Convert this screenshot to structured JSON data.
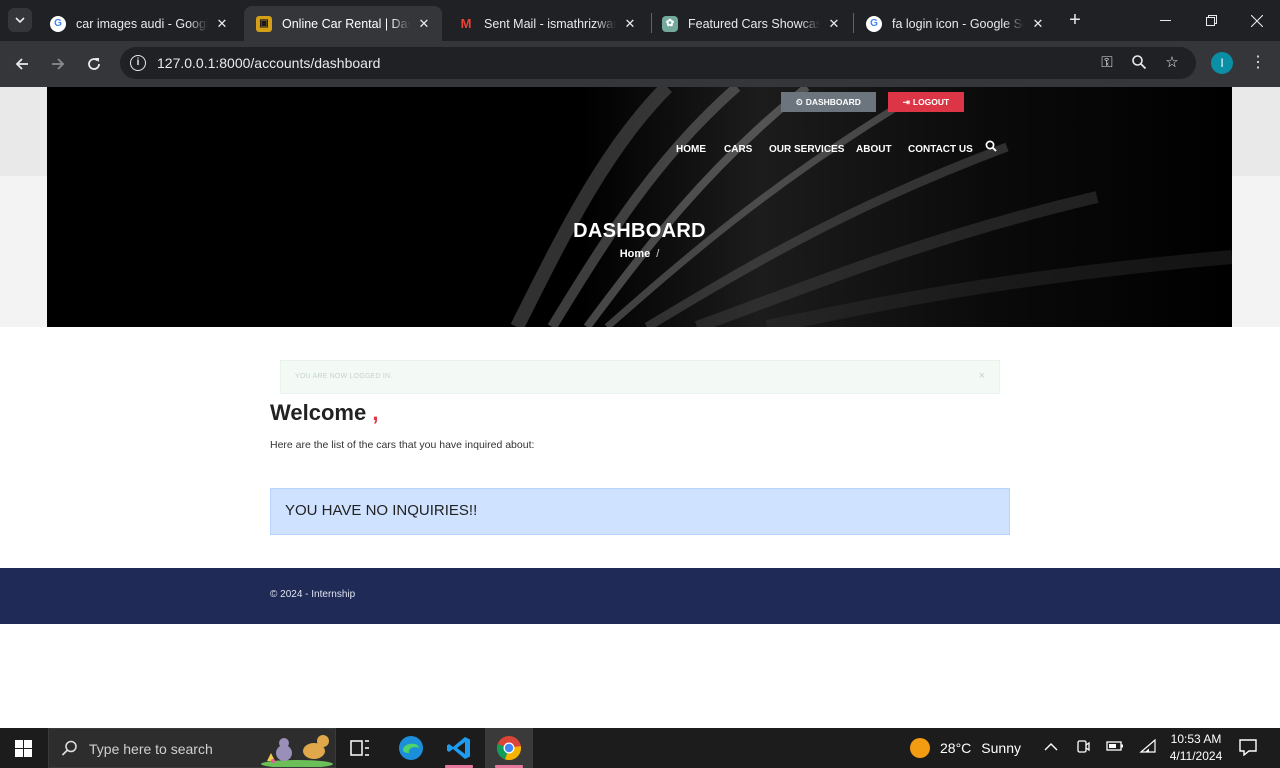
{
  "browser": {
    "tabs": [
      {
        "title": "car images audi - Google Search",
        "favicon": "google-icon",
        "active": false
      },
      {
        "title": "Online Car Rental | Dashboard",
        "favicon": "site-logo-icon",
        "active": true
      },
      {
        "title": "Sent Mail - ismathrizwana",
        "favicon": "gmail-icon",
        "active": false
      },
      {
        "title": "Featured Cars Showcase",
        "favicon": "chatgpt-icon",
        "active": false
      },
      {
        "title": "fa login icon - Google Search",
        "favicon": "google-icon",
        "active": false
      }
    ],
    "url": "127.0.0.1:8000/accounts/dashboard",
    "profile_initial": "I"
  },
  "page": {
    "topbar": {
      "dashboard_label": "DASHBOARD",
      "logout_label": "LOGOUT"
    },
    "nav": [
      "HOME",
      "CARS",
      "OUR SERVICES",
      "ABOUT",
      "CONTACT US"
    ],
    "hero": {
      "title": "DASHBOARD",
      "breadcrumb": "Home",
      "breadcrumb_sep": "/"
    },
    "flash": {
      "message": "YOU ARE NOW LOGGED IN.",
      "close": "×"
    },
    "welcome": {
      "heading": "Welcome",
      "comma": ","
    },
    "lead": "Here are the list of the cars that you have inquired about:",
    "no_inquiries": "YOU HAVE NO INQUIRIES!!",
    "footer": "© 2024 - Internship"
  },
  "taskbar": {
    "search_placeholder": "Type here to search",
    "weather": {
      "temp": "28°C",
      "condition": "Sunny"
    },
    "time": "10:53 AM",
    "date": "4/11/2024"
  },
  "colors": {
    "dashboard_button": "#6c757d",
    "logout_button": "#dc3545",
    "info_alert": "#cfe2ff",
    "footer": "#1f2a56"
  }
}
